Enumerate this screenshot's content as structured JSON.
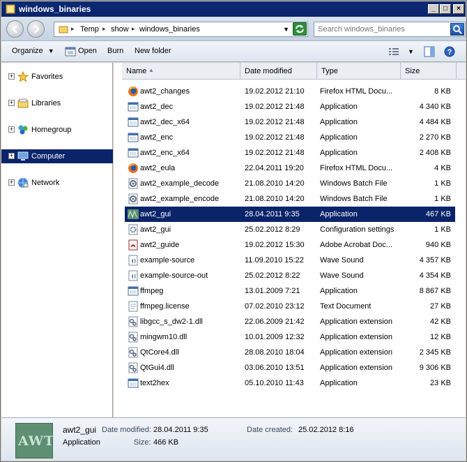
{
  "window": {
    "title": "windows_binaries"
  },
  "address": {
    "crumbs": [
      "Temp",
      "show",
      "windows_binaries"
    ]
  },
  "search": {
    "placeholder": "Search windows_binaries"
  },
  "toolbar": {
    "organize": "Organize",
    "open": "Open",
    "burn": "Burn",
    "new_folder": "New folder"
  },
  "nav": {
    "items": [
      {
        "label": "Favorites",
        "icon": "star-icon"
      },
      {
        "label": "Libraries",
        "icon": "libraries-icon"
      },
      {
        "label": "Homegroup",
        "icon": "homegroup-icon"
      },
      {
        "label": "Computer",
        "icon": "computer-icon",
        "selected": true
      },
      {
        "label": "Network",
        "icon": "network-icon"
      }
    ]
  },
  "columns": {
    "name": "Name",
    "date": "Date modified",
    "type": "Type",
    "size": "Size"
  },
  "files": [
    {
      "name": "awt2_changes",
      "date": "19.02.2012 21:10",
      "type": "Firefox HTML Docu...",
      "size": "8 KB",
      "icon": "firefox-icon"
    },
    {
      "name": "awt2_dec",
      "date": "19.02.2012 21:48",
      "type": "Application",
      "size": "4 340 KB",
      "icon": "application-icon"
    },
    {
      "name": "awt2_dec_x64",
      "date": "19.02.2012 21:48",
      "type": "Application",
      "size": "4 484 KB",
      "icon": "application-icon"
    },
    {
      "name": "awt2_enc",
      "date": "19.02.2012 21:48",
      "type": "Application",
      "size": "2 270 KB",
      "icon": "application-icon"
    },
    {
      "name": "awt2_enc_x64",
      "date": "19.02.2012 21:48",
      "type": "Application",
      "size": "2 408 KB",
      "icon": "application-icon"
    },
    {
      "name": "awt2_eula",
      "date": "22.04.2011 19:20",
      "type": "Firefox HTML Docu...",
      "size": "4 KB",
      "icon": "firefox-icon"
    },
    {
      "name": "awt2_example_decode",
      "date": "21.08.2010 14:20",
      "type": "Windows Batch File",
      "size": "1 KB",
      "icon": "batch-file-icon"
    },
    {
      "name": "awt2_example_encode",
      "date": "21.08.2010 14:20",
      "type": "Windows Batch File",
      "size": "1 KB",
      "icon": "batch-file-icon"
    },
    {
      "name": "awt2_gui",
      "date": "28.04.2011 9:35",
      "type": "Application",
      "size": "467 KB",
      "icon": "awt-app-icon",
      "selected": true
    },
    {
      "name": "awt2_gui",
      "date": "25.02.2012 8:29",
      "type": "Configuration settings",
      "size": "1 KB",
      "icon": "config-settings-icon"
    },
    {
      "name": "awt2_guide",
      "date": "19.02.2012 15:30",
      "type": "Adobe Acrobat Doc...",
      "size": "940 KB",
      "icon": "pdf-icon"
    },
    {
      "name": "example-source",
      "date": "11.09.2010 15:22",
      "type": "Wave Sound",
      "size": "4 357 KB",
      "icon": "wave-sound-icon"
    },
    {
      "name": "example-source-out",
      "date": "25.02.2012 8:22",
      "type": "Wave Sound",
      "size": "4 354 KB",
      "icon": "wave-sound-icon"
    },
    {
      "name": "ffmpeg",
      "date": "13.01.2009 7:21",
      "type": "Application",
      "size": "8 867 KB",
      "icon": "application-icon"
    },
    {
      "name": "ffmpeg.license",
      "date": "07.02.2010 23:12",
      "type": "Text Document",
      "size": "27 KB",
      "icon": "text-document-icon"
    },
    {
      "name": "libgcc_s_dw2-1.dll",
      "date": "22.06.2009 21:42",
      "type": "Application extension",
      "size": "42 KB",
      "icon": "dll-icon"
    },
    {
      "name": "mingwm10.dll",
      "date": "10.01.2009 12:32",
      "type": "Application extension",
      "size": "12 KB",
      "icon": "dll-icon"
    },
    {
      "name": "QtCore4.dll",
      "date": "28.08.2010 18:04",
      "type": "Application extension",
      "size": "2 345 KB",
      "icon": "dll-icon"
    },
    {
      "name": "QtGui4.dll",
      "date": "03.06.2010 13:51",
      "type": "Application extension",
      "size": "9 306 KB",
      "icon": "dll-icon"
    },
    {
      "name": "text2hex",
      "date": "05.10.2010 11:43",
      "type": "Application",
      "size": "23 KB",
      "icon": "application-icon"
    }
  ],
  "details": {
    "thumb_text": "AWT",
    "name": "awt2_gui",
    "type": "Application",
    "date_modified_label": "Date modified:",
    "date_modified": "28.04.2011 9:35",
    "size_label": "Size:",
    "size": "466 KB",
    "date_created_label": "Date created:",
    "date_created": "25.02.2012 8:16"
  },
  "colors": {
    "selection": "#0a246a",
    "titlebar": "#0a246a",
    "window_frame": "#d4d0c8"
  }
}
